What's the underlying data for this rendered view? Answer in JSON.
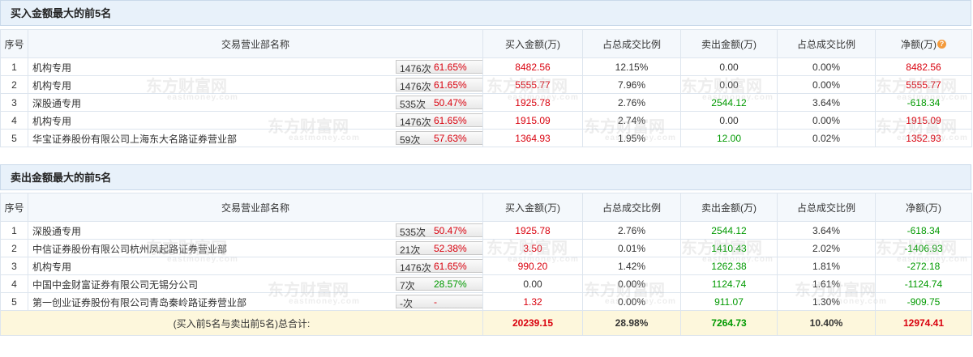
{
  "watermark": {
    "text": "东方财富网",
    "sub": "eastmoney.com"
  },
  "buy": {
    "title": "买入金额最大的前5名",
    "headers": {
      "idx": "序号",
      "name": "交易营业部名称",
      "buy": "买入金额(万)",
      "buy_ratio": "占总成交比例",
      "sell": "卖出金额(万)",
      "sell_ratio": "占总成交比例",
      "net": "净额(万)"
    },
    "rows": [
      {
        "idx": "1",
        "name": "机构专用",
        "count": "1476次",
        "rate": "61.65%",
        "buy": "8482.56",
        "buy_ratio": "12.15%",
        "sell": "0.00",
        "sell_ratio": "0.00%",
        "net": "8482.56"
      },
      {
        "idx": "2",
        "name": "机构专用",
        "count": "1476次",
        "rate": "61.65%",
        "buy": "5555.77",
        "buy_ratio": "7.96%",
        "sell": "0.00",
        "sell_ratio": "0.00%",
        "net": "5555.77"
      },
      {
        "idx": "3",
        "name": "深股通专用",
        "count": "535次",
        "rate": "50.47%",
        "buy": "1925.78",
        "buy_ratio": "2.76%",
        "sell": "2544.12",
        "sell_ratio": "3.64%",
        "net": "-618.34"
      },
      {
        "idx": "4",
        "name": "机构专用",
        "count": "1476次",
        "rate": "61.65%",
        "buy": "1915.09",
        "buy_ratio": "2.74%",
        "sell": "0.00",
        "sell_ratio": "0.00%",
        "net": "1915.09"
      },
      {
        "idx": "5",
        "name": "华宝证券股份有限公司上海东大名路证券营业部",
        "count": "59次",
        "rate": "57.63%",
        "buy": "1364.93",
        "buy_ratio": "1.95%",
        "sell": "12.00",
        "sell_ratio": "0.02%",
        "net": "1352.93"
      }
    ]
  },
  "sell": {
    "title": "卖出金额最大的前5名",
    "headers": {
      "idx": "序号",
      "name": "交易营业部名称",
      "buy": "买入金额(万)",
      "buy_ratio": "占总成交比例",
      "sell": "卖出金额(万)",
      "sell_ratio": "占总成交比例",
      "net": "净额(万)"
    },
    "rows": [
      {
        "idx": "1",
        "name": "深股通专用",
        "count": "535次",
        "rate": "50.47%",
        "buy": "1925.78",
        "buy_ratio": "2.76%",
        "sell": "2544.12",
        "sell_ratio": "3.64%",
        "net": "-618.34"
      },
      {
        "idx": "2",
        "name": "中信证券股份有限公司杭州凤起路证券营业部",
        "count": "21次",
        "rate": "52.38%",
        "buy": "3.50",
        "buy_ratio": "0.01%",
        "sell": "1410.43",
        "sell_ratio": "2.02%",
        "net": "-1406.93"
      },
      {
        "idx": "3",
        "name": "机构专用",
        "count": "1476次",
        "rate": "61.65%",
        "buy": "990.20",
        "buy_ratio": "1.42%",
        "sell": "1262.38",
        "sell_ratio": "1.81%",
        "net": "-272.18"
      },
      {
        "idx": "4",
        "name": "中国中金财富证券有限公司无锡分公司",
        "count": "7次",
        "rate": "28.57%",
        "buy": "0.00",
        "buy_ratio": "0.00%",
        "sell": "1124.74",
        "sell_ratio": "1.61%",
        "net": "-1124.74"
      },
      {
        "idx": "5",
        "name": "第一创业证券股份有限公司青岛秦岭路证券营业部",
        "count": "-次",
        "rate": "-",
        "buy": "1.32",
        "buy_ratio": "0.00%",
        "sell": "911.07",
        "sell_ratio": "1.30%",
        "net": "-909.75"
      }
    ]
  },
  "total": {
    "label": "(买入前5名与卖出前5名)总合计:",
    "buy": "20239.15",
    "buy_ratio": "28.98%",
    "sell": "7264.73",
    "sell_ratio": "10.40%",
    "net": "12974.41"
  }
}
